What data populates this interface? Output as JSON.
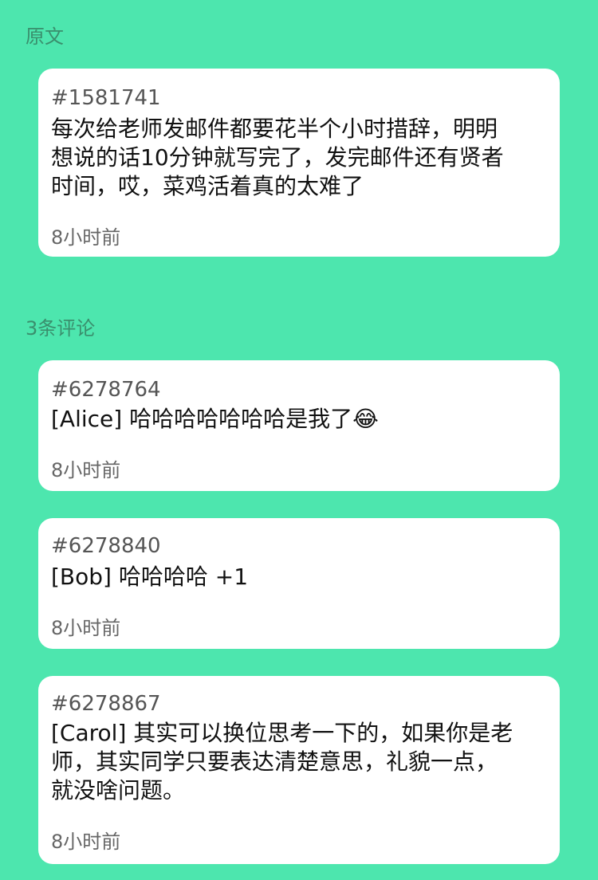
{
  "sections": {
    "original_label": "原文",
    "comments_label": "3条评论"
  },
  "post": {
    "id": "#1581741",
    "text": "每次给老师发邮件都要花半个小时措辞，明明\n想说的话10分钟就写完了，发完邮件还有贤者\n时间，哎，菜鸡活着真的太难了",
    "time": "8小时前"
  },
  "comments": [
    {
      "id": "#6278764",
      "text": "[Alice] 哈哈哈哈哈哈哈是我了😂",
      "time": "8小时前"
    },
    {
      "id": "#6278840",
      "text": "[Bob] 哈哈哈哈 +1",
      "time": "8小时前"
    },
    {
      "id": "#6278867",
      "text": "[Carol] 其实可以换位思考一下的，如果你是老\n师，其实同学只要表达清楚意思，礼貌一点，\n就没啥问题。",
      "time": "8小时前"
    }
  ]
}
